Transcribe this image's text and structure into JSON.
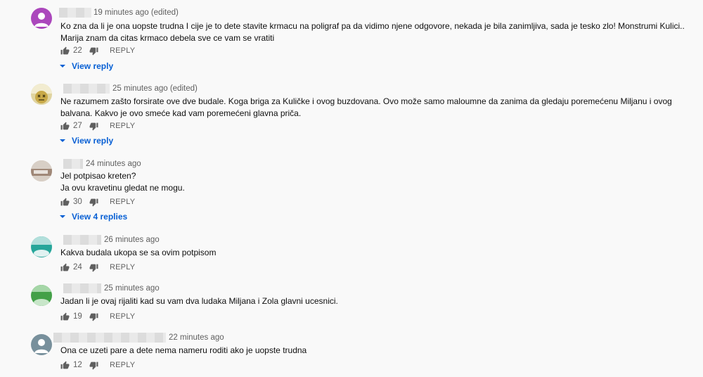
{
  "comments": [
    {
      "avatar_color": "#ab47bc",
      "meta": "19 minutes ago (edited)",
      "text": "Ko zna da li je ona uopste trudna I cije je to dete stavite krmacu na poligraf pa da vidimo njene odgovore, nekada je bila zanimljiva, sada je tesko zlo! Monstrumi Kulici.. Marija znam da citas krmaco debela sve ce vam se vratiti",
      "likes": "22",
      "reply_label": "REPLY",
      "view_replies": "View reply"
    },
    {
      "avatar_color": "#c8b35a",
      "meta": "25 minutes ago (edited)",
      "text": "Ne razumem zašto forsirate ove dve budale. Koga briga za Kuličke i  ovog buzdovana. Ovo može samo maloumne da zanima da gledaju poremećenu Miljanu i ovog balvana. Kakvo je ovo smeće kad vam poremećeni glavna priča.",
      "likes": "27",
      "reply_label": "REPLY",
      "view_replies": "View reply"
    },
    {
      "avatar_color": "#b9a99a",
      "meta": "24 minutes ago",
      "text_lines": [
        "Jel potpisao kreten?",
        "Ja ovu kravetinu gledat ne mogu."
      ],
      "likes": "30",
      "reply_label": "REPLY",
      "view_replies": "View 4 replies"
    },
    {
      "avatar_color": "#26a69a",
      "meta": "26 minutes ago",
      "text": "Kakva budala ukopa se sa ovim potpisom",
      "likes": "24",
      "reply_label": "REPLY"
    },
    {
      "avatar_color": "#43a047",
      "meta": "25 minutes ago",
      "text": "Jadan li je ovaj rijaliti kad su vam dva ludaka Miljana i Zola glavni ucesnici.",
      "likes": "19",
      "reply_label": "REPLY"
    },
    {
      "avatar_color": "#78909c",
      "meta": "22 minutes ago",
      "text": "Ona ce uzeti pare a dete nema nameru roditi ako je uopste trudna",
      "likes": "12",
      "reply_label": "REPLY"
    }
  ]
}
